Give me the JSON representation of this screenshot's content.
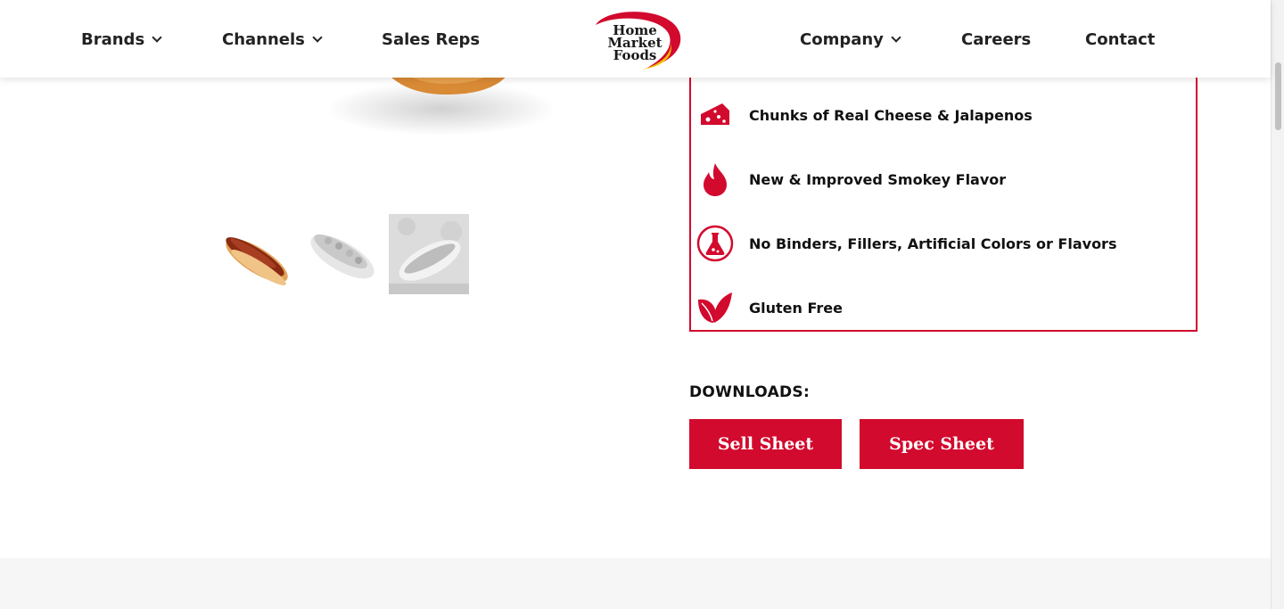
{
  "nav": {
    "brands": "Brands",
    "channels": "Channels",
    "sales_reps": "Sales Reps",
    "company": "Company",
    "careers": "Careers",
    "contact": "Contact"
  },
  "logo": {
    "line1": "Home",
    "line2": "Market",
    "line3": "Foods"
  },
  "features": [
    {
      "icon": "cheese-icon",
      "label": "Chunks of Real Cheese & Jalapenos"
    },
    {
      "icon": "flame-icon",
      "label": "New & Improved Smokey Flavor"
    },
    {
      "icon": "flask-icon",
      "label": "No Binders, Fillers, Artificial Colors or Flavors"
    },
    {
      "icon": "leaf-icon",
      "label": "Gluten Free"
    }
  ],
  "downloads": {
    "title": "DOWNLOADS:",
    "sell_sheet": "Sell Sheet",
    "spec_sheet": "Spec Sheet"
  },
  "colors": {
    "brand_red": "#d20a2e",
    "logo_yellow": "#f2c400"
  }
}
